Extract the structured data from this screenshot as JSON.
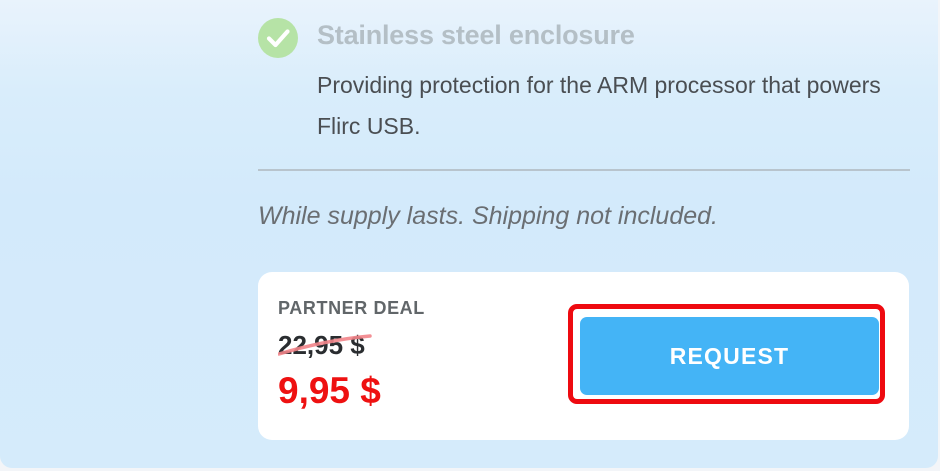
{
  "feature": {
    "icon": "checkmark-circle-icon",
    "title": "Stainless steel enclosure",
    "description": "Providing protection for the ARM processor that powers Flirc USB."
  },
  "supply_note": "While supply lasts. Shipping not included.",
  "deal": {
    "label": "PARTNER DEAL",
    "old_price": "22,95 $",
    "new_price": "9,95 $",
    "button_label": "REQUEST"
  },
  "colors": {
    "accent_button": "#44b4f6",
    "sale_price": "#ee1111",
    "highlight_outline": "#ee0a10",
    "check_icon": "#b6e3a6"
  }
}
